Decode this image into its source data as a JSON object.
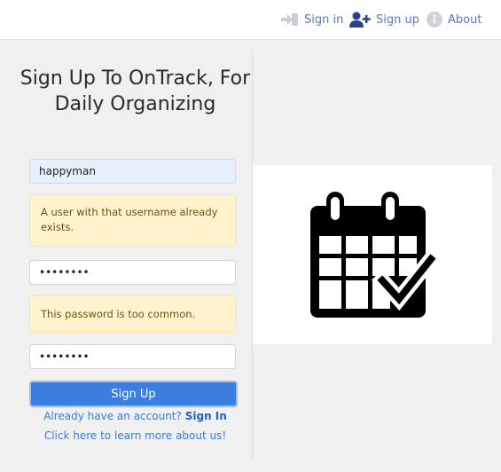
{
  "nav": {
    "signin_label": "Sign in",
    "signup_label": "Sign up",
    "about_label": "About"
  },
  "form": {
    "title": "Sign Up To OnTrack, For Daily Organizing",
    "username_value": "happyman",
    "username_error": "A user with that username already exists.",
    "password_value": "••••••••",
    "password_error": "This password is too common.",
    "confirm_value": "••••••••",
    "submit_label": "Sign Up",
    "account_prompt": "Already have an account?",
    "account_link": "Sign In",
    "learn_more": "Click here to learn more about us!"
  },
  "illustration": {
    "icon": "calendar-check-icon"
  },
  "colors": {
    "link": "#5577c9",
    "primary": "#3c7de0",
    "warning_bg": "#fff3cd"
  }
}
